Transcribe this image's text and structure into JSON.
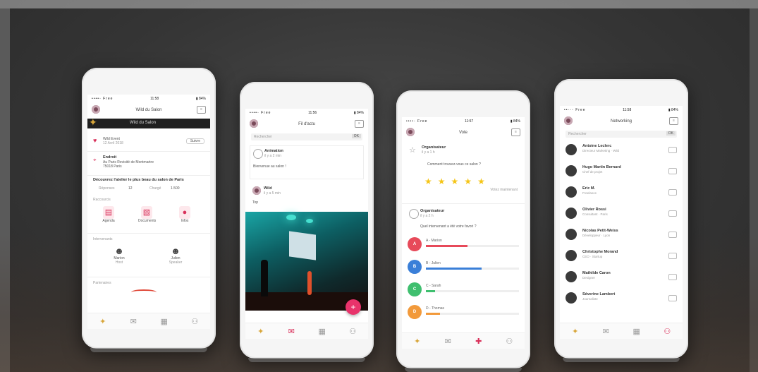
{
  "phones": [
    {
      "status": {
        "carrier": "••••◦ Free",
        "time": "11:58",
        "battery": "▮ 84%"
      },
      "title": "Wild du Salon",
      "banner_text": "Wild du Salon",
      "event": {
        "organizer": "Wild Event",
        "date": "12 Avril 2018",
        "action": "Suivre"
      },
      "place": {
        "label": "Endroit",
        "address": "Au Paris Revisité de Montmartre",
        "city": "75018 Paris"
      },
      "description": "Découvrez l'atelier le plus beau du salon de Paris",
      "stats": [
        "Réponses",
        "12",
        "Chargé",
        "1.500"
      ],
      "sections": {
        "shortcuts": "Raccourcis",
        "speakers": "Intervenants",
        "sponsors": "Partenaires"
      },
      "shortcuts": [
        {
          "label": "Agenda",
          "icon": "calendar-icon"
        },
        {
          "label": "Documents",
          "icon": "document-icon"
        },
        {
          "label": "Infos",
          "icon": "info-icon"
        }
      ],
      "speakers": [
        {
          "name": "Marion",
          "role": "Host"
        },
        {
          "name": "Julien",
          "role": "Speaker"
        }
      ],
      "tabs": [
        {
          "icon": "sparkle-icon",
          "glyph": "✦",
          "state": "gold"
        },
        {
          "icon": "chat-icon",
          "glyph": "✉",
          "state": ""
        },
        {
          "icon": "grid-icon",
          "glyph": "▦",
          "state": ""
        },
        {
          "icon": "people-icon",
          "glyph": "⚇",
          "state": ""
        }
      ]
    },
    {
      "status": {
        "carrier": "••••◦ Free",
        "time": "11:56",
        "battery": "▮ 84%"
      },
      "title": "Fil d'actu",
      "search": {
        "placeholder": "Rechercher",
        "button": "OK"
      },
      "post1": {
        "author": "Animation",
        "time": "il y a 2 min",
        "body": "Bienvenue au salon !"
      },
      "post2": {
        "author": "Wild",
        "time": "il y a 5 min",
        "body": "Top"
      },
      "fab": "+",
      "tabs": [
        {
          "icon": "sparkle-icon",
          "glyph": "✦",
          "state": "gold"
        },
        {
          "icon": "chat-icon",
          "glyph": "✉",
          "state": "active"
        },
        {
          "icon": "grid-icon",
          "glyph": "▦",
          "state": ""
        },
        {
          "icon": "people-icon",
          "glyph": "⚇",
          "state": ""
        }
      ]
    },
    {
      "status": {
        "carrier": "••••◦ Free",
        "time": "11:57",
        "battery": "▮ 84%"
      },
      "title": "Vote",
      "rating": {
        "author": "Organisateur",
        "time": "il y a 1 h",
        "question": "Comment trouvez-vous ce salon ?",
        "stars": 5,
        "caption": "Votez maintenant"
      },
      "poll": {
        "author": "Organisateur",
        "time": "il y a 2 h",
        "question": "Quel intervenant a été votre favori ?"
      },
      "options": [
        {
          "letter": "A",
          "label": "A - Marion",
          "color": "#e74a5a",
          "share": 0.45
        },
        {
          "letter": "B",
          "label": "B - Julien",
          "color": "#3a7fd8",
          "share": 0.6
        },
        {
          "letter": "C",
          "label": "C - Sarah",
          "color": "#3fbf6f",
          "share": 0.1
        },
        {
          "letter": "D",
          "label": "D - Thomas",
          "color": "#f29a3b",
          "share": 0.15
        }
      ],
      "tabs": [
        {
          "icon": "sparkle-icon",
          "glyph": "✦",
          "state": "gold"
        },
        {
          "icon": "chat-icon",
          "glyph": "✉",
          "state": ""
        },
        {
          "icon": "thumb-icon",
          "glyph": "✚",
          "state": "active"
        },
        {
          "icon": "people-icon",
          "glyph": "⚇",
          "state": ""
        }
      ]
    },
    {
      "status": {
        "carrier": "••◦◦◦ Free",
        "time": "11:58",
        "battery": "▮ 84%"
      },
      "title": "Networking",
      "search": {
        "placeholder": "Rechercher",
        "button": "OK"
      },
      "contacts": [
        {
          "name": "Antoine Leclerc",
          "sub": "Directeur Marketing · Wild"
        },
        {
          "name": "Hugo Martin Bernard",
          "sub": "Chef de projet"
        },
        {
          "name": "Eric M.",
          "sub": "Freelance"
        },
        {
          "name": "Olivier Rossi",
          "sub": "Consultant · Paris"
        },
        {
          "name": "Nicolas Petit-Weiss",
          "sub": "Développeur · Lyon"
        },
        {
          "name": "Christophe Morand",
          "sub": "CEO · Startup"
        },
        {
          "name": "Mathilde Caron",
          "sub": "Designer"
        },
        {
          "name": "Séverine Lambert",
          "sub": "Journaliste"
        }
      ],
      "tabs": [
        {
          "icon": "sparkle-icon",
          "glyph": "✦",
          "state": "gold"
        },
        {
          "icon": "chat-icon",
          "glyph": "✉",
          "state": ""
        },
        {
          "icon": "grid-icon",
          "glyph": "▦",
          "state": ""
        },
        {
          "icon": "people-icon",
          "glyph": "⚇",
          "state": "active"
        }
      ]
    }
  ]
}
